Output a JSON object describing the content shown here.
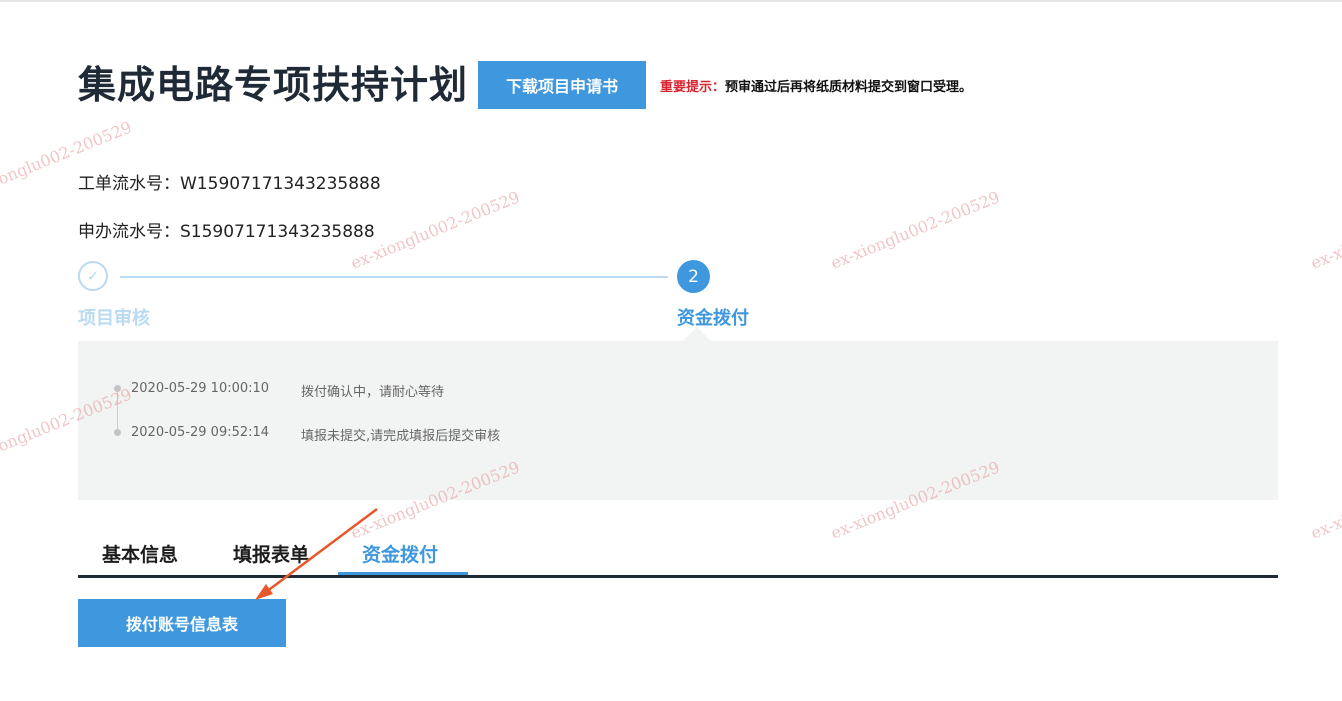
{
  "page": {
    "title": "集成电路专项扶持计划",
    "download_button": "下载项目申请书",
    "notice_label": "重要提示：",
    "notice_text": "预审通过后再将纸质材料提交到窗口受理。"
  },
  "serials": {
    "work_order": "工单流水号：W15907171343235888",
    "application": "申办流水号：S15907171343235888"
  },
  "steps": [
    {
      "label": "项目审核",
      "status": "done",
      "icon": "check-icon"
    },
    {
      "label": "资金拨付",
      "status": "active",
      "number": "2"
    }
  ],
  "timeline": [
    {
      "time": "2020-05-29 10:00:10",
      "message": "拨付确认中，请耐心等待"
    },
    {
      "time": "2020-05-29 09:52:14",
      "message": "填报未提交,请完成填报后提交审核"
    }
  ],
  "tabs": [
    {
      "label": "基本信息"
    },
    {
      "label": "填报表单"
    },
    {
      "label": "资金拨付",
      "active": true
    }
  ],
  "account_button": "拨付账号信息表",
  "watermark_text": "ex-xionglu002-200529",
  "colors": {
    "primary": "#3f97dd",
    "notice_red": "#d9232e",
    "annotation_arrow": "#e8572a",
    "panel_bg": "#f2f3f3"
  }
}
